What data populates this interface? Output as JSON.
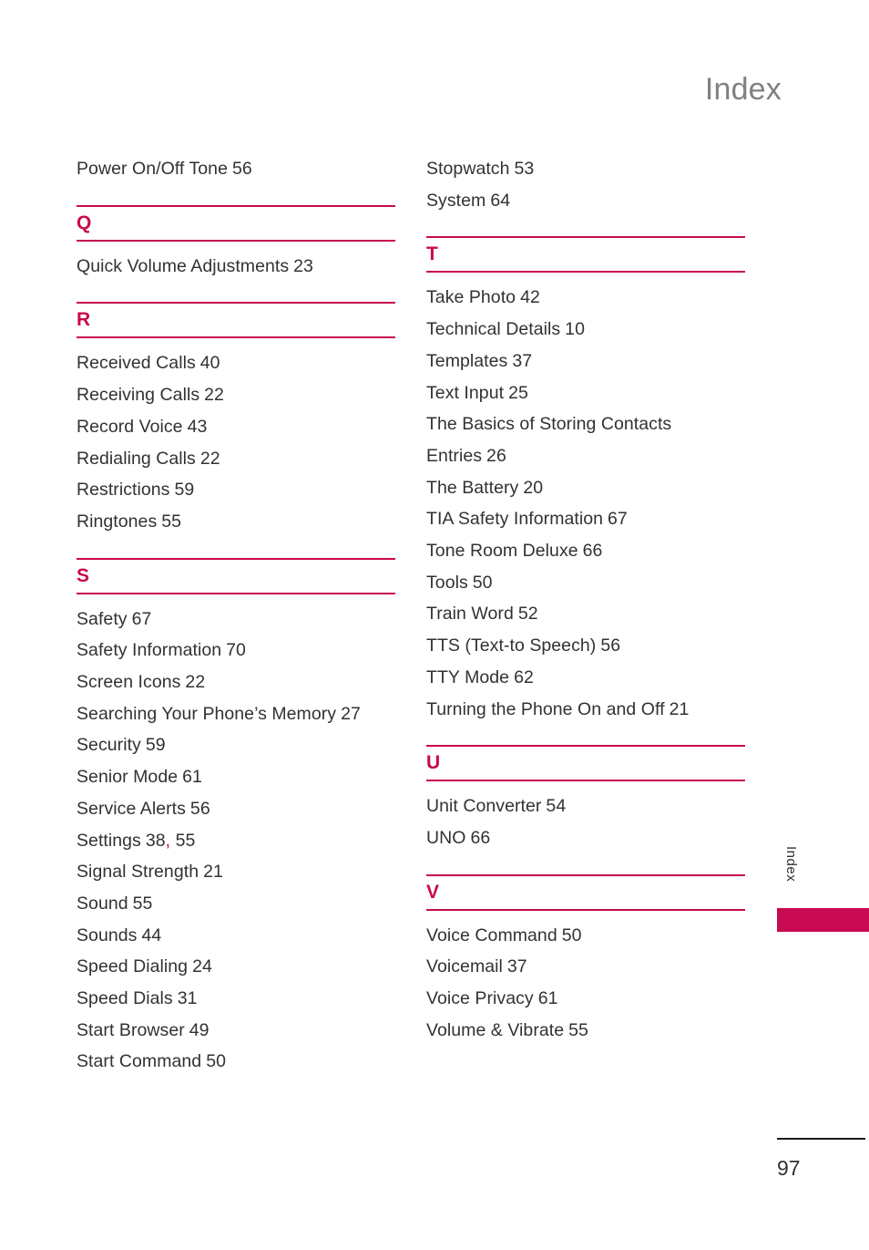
{
  "header": {
    "title": "Index"
  },
  "side_tab": {
    "label": "Index"
  },
  "footer": {
    "page_number": "97"
  },
  "colors": {
    "accent": "#C80A50",
    "text": "#323232",
    "header_gray": "#808085"
  },
  "columns": [
    {
      "id": "left",
      "blocks": [
        {
          "type": "entries",
          "items": [
            {
              "title": "Power On/Off Tone",
              "pages": "56"
            }
          ]
        },
        {
          "type": "section",
          "letter": "Q"
        },
        {
          "type": "entries",
          "items": [
            {
              "title": "Quick Volume Adjustments",
              "pages": "23"
            }
          ]
        },
        {
          "type": "section",
          "letter": "R"
        },
        {
          "type": "entries",
          "items": [
            {
              "title": "Received Calls",
              "pages": "40"
            },
            {
              "title": "Receiving Calls",
              "pages": "22"
            },
            {
              "title": "Record Voice",
              "pages": "43"
            },
            {
              "title": "Redialing Calls",
              "pages": "22"
            },
            {
              "title": "Restrictions",
              "pages": "59"
            },
            {
              "title": "Ringtones",
              "pages": "55"
            }
          ]
        },
        {
          "type": "section",
          "letter": "S"
        },
        {
          "type": "entries",
          "items": [
            {
              "title": "Safety",
              "pages": "67"
            },
            {
              "title": "Safety Information",
              "pages": "70"
            },
            {
              "title": "Screen Icons",
              "pages": "22"
            },
            {
              "title": "Searching Your Phone’s Memory",
              "pages": "27"
            },
            {
              "title": "Security",
              "pages": "59"
            },
            {
              "title": "Senior Mode",
              "pages": "61"
            },
            {
              "title": "Service Alerts",
              "pages": "56"
            },
            {
              "title": "Settings",
              "pages": "38, 55",
              "accent_separator": true
            },
            {
              "title": "Signal Strength",
              "pages": "21"
            },
            {
              "title": "Sound",
              "pages": "55"
            },
            {
              "title": "Sounds",
              "pages": "44"
            },
            {
              "title": "Speed Dialing",
              "pages": "24"
            },
            {
              "title": "Speed Dials",
              "pages": "31"
            },
            {
              "title": "Start Browser",
              "pages": "49"
            },
            {
              "title": "Start Command",
              "pages": "50"
            }
          ]
        }
      ]
    },
    {
      "id": "right",
      "blocks": [
        {
          "type": "entries",
          "items": [
            {
              "title": "Stopwatch",
              "pages": "53"
            },
            {
              "title": "System",
              "pages": "64"
            }
          ]
        },
        {
          "type": "section",
          "letter": "T"
        },
        {
          "type": "entries",
          "items": [
            {
              "title": "Take Photo",
              "pages": "42"
            },
            {
              "title": "Technical Details",
              "pages": "10"
            },
            {
              "title": "Templates",
              "pages": "37"
            },
            {
              "title": "Text Input",
              "pages": "25"
            },
            {
              "title": "The Basics of Storing Contacts Entries",
              "pages": "26",
              "wrapped": true
            },
            {
              "title": "The Battery",
              "pages": "20"
            },
            {
              "title": "TIA Safety Information",
              "pages": "67"
            },
            {
              "title": "Tone Room Deluxe",
              "pages": "66"
            },
            {
              "title": "Tools",
              "pages": "50"
            },
            {
              "title": "Train Word",
              "pages": "52"
            },
            {
              "title": "TTS (Text-to Speech)",
              "pages": "56"
            },
            {
              "title": "TTY Mode",
              "pages": "62"
            },
            {
              "title": "Turning the Phone On and Off",
              "pages": "21"
            }
          ]
        },
        {
          "type": "section",
          "letter": "U"
        },
        {
          "type": "entries",
          "items": [
            {
              "title": "Unit Converter",
              "pages": "54"
            },
            {
              "title": "UNO",
              "pages": "66"
            }
          ]
        },
        {
          "type": "section",
          "letter": "V"
        },
        {
          "type": "entries",
          "items": [
            {
              "title": "Voice Command",
              "pages": "50"
            },
            {
              "title": "Voicemail",
              "pages": "37"
            },
            {
              "title": "Voice Privacy",
              "pages": "61"
            },
            {
              "title": "Volume & Vibrate",
              "pages": "55"
            }
          ]
        }
      ]
    }
  ]
}
